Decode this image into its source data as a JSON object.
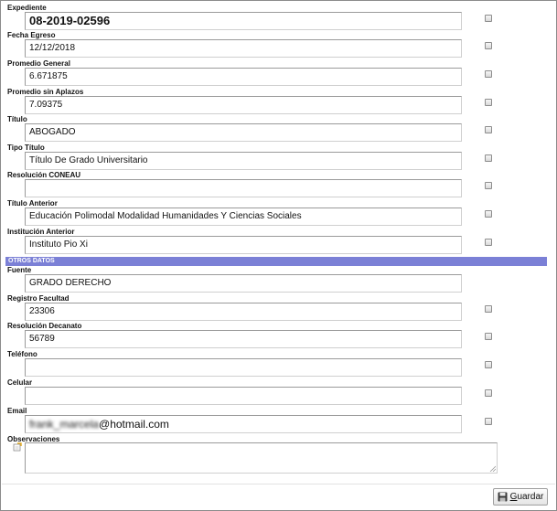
{
  "fields": [
    {
      "label": "Expediente",
      "value": "08-2019-02596"
    },
    {
      "label": "Fecha Egreso",
      "value": "12/12/2018"
    },
    {
      "label": "Promedio General",
      "value": "6.671875"
    },
    {
      "label": "Promedio sin Aplazos",
      "value": "7.09375"
    },
    {
      "label": "Título",
      "value": "ABOGADO"
    },
    {
      "label": "Tipo Título",
      "value": "Título De Grado Universitario"
    },
    {
      "label": "Resolución CONEAU",
      "value": ""
    },
    {
      "label": "Título Anterior",
      "value": "Educación Polimodal Modalidad Humanidades Y Ciencias Sociales"
    },
    {
      "label": "Institución Anterior",
      "value": "Instituto Pio Xi"
    }
  ],
  "section_title": "OTROS DATOS",
  "otros": [
    {
      "label": "Fuente",
      "value": "GRADO DERECHO"
    },
    {
      "label": "Registro Facultad",
      "value": "23306"
    },
    {
      "label": "Resolución Decanato",
      "value": "56789"
    },
    {
      "label": "Teléfono",
      "value": ""
    },
    {
      "label": "Celular",
      "value": ""
    },
    {
      "label": "Email",
      "value_hidden": "frank_marcela",
      "value_visible": "@hotmail.com"
    }
  ],
  "observaciones": {
    "label": "Observaciones",
    "value": ""
  },
  "save": {
    "first_letter": "G",
    "rest": "uardar",
    "icon": "floppy-disk-icon"
  },
  "colors": {
    "section_bar": "#7b80d6",
    "section_text": "#ffffff"
  }
}
